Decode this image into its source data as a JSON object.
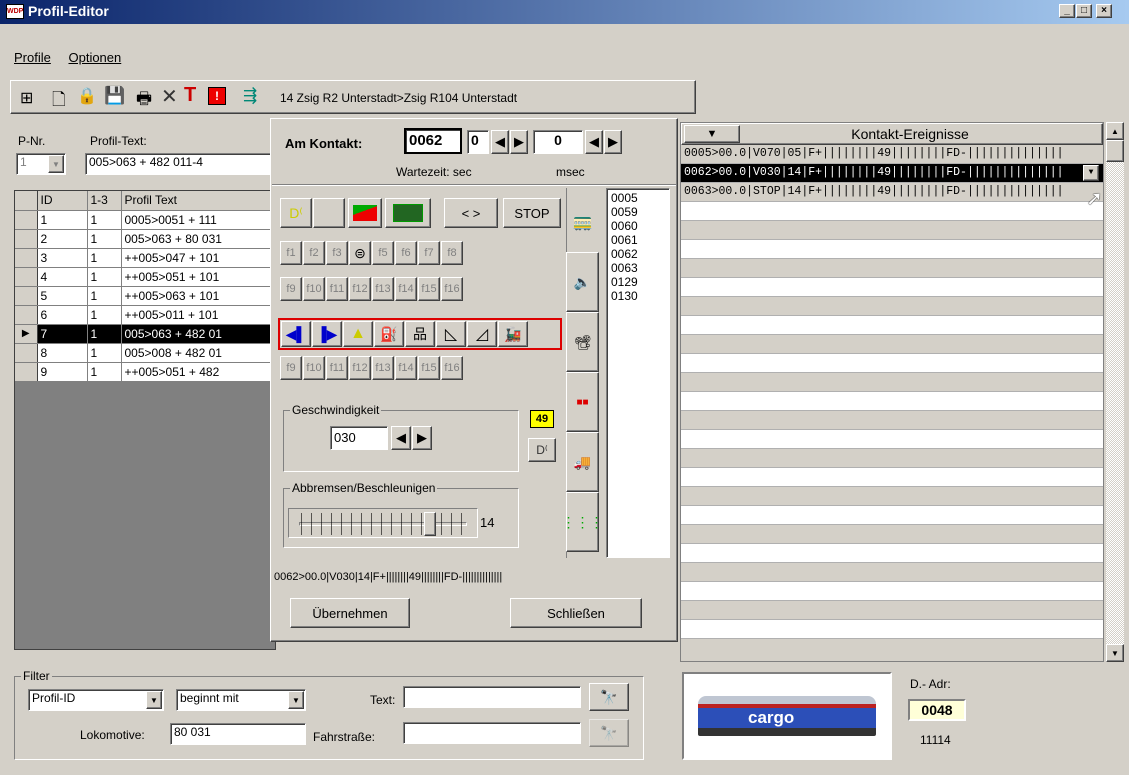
{
  "window": {
    "title": "Profil-Editor",
    "app_icon": "woip-logo-icon"
  },
  "menu": {
    "profile": "Profile",
    "optionen": "Optionen"
  },
  "toolbar": {
    "route_text": "14 Zsig R2 Unterstadt>Zsig R104 Unterstadt",
    "icons": [
      "tree-icon",
      "new-document-icon",
      "lock-document-icon",
      "save-icon",
      "print-icon",
      "delete-icon",
      "filter-t-icon",
      "alert-icon",
      "exit-icon"
    ]
  },
  "left": {
    "pnr_label": "P-Nr.",
    "profiltext_label": "Profil-Text:",
    "pnr_value": "1",
    "profiltext_value": "005>063 + 482 011-4",
    "columns": [
      "ID",
      "1-3",
      "Profil Text"
    ],
    "rows": [
      {
        "id": "1",
        "k": "1",
        "text": "0005>0051 + 111"
      },
      {
        "id": "2",
        "k": "1",
        "text": "005>063 + 80 031"
      },
      {
        "id": "3",
        "k": "1",
        "text": "++005>047 + 101"
      },
      {
        "id": "4",
        "k": "1",
        "text": "++005>051 + 101"
      },
      {
        "id": "5",
        "k": "1",
        "text": "++005>063 + 101"
      },
      {
        "id": "6",
        "k": "1",
        "text": "++005>011 + 101"
      },
      {
        "id": "7",
        "k": "1",
        "text": "005>063 + 482 01"
      },
      {
        "id": "8",
        "k": "1",
        "text": "005>008 + 482 01"
      },
      {
        "id": "9",
        "k": "1",
        "text": "++005>051 + 482"
      }
    ],
    "selected_index": 6
  },
  "dialog": {
    "am_kontakt_label": "Am Kontakt:",
    "kontakt_value": "0062",
    "wait_sec": "0",
    "wait_msec": "0",
    "wartezeit_label": "Wartezeit: sec",
    "msec_label": "msec",
    "stop_label": "STOP",
    "arrows_label": "< >",
    "f_row1": [
      "f1",
      "f2",
      "f3",
      "",
      "f5",
      "f6",
      "f7",
      "f8"
    ],
    "f_row2": [
      "f9",
      "f10",
      "f11",
      "f12",
      "f13",
      "f14",
      "f15",
      "f16"
    ],
    "f_row3": [
      "f9",
      "f10",
      "f11",
      "f12",
      "f13",
      "f14",
      "f15",
      "f16"
    ],
    "geschw_label": "Geschwindigkeit",
    "geschw_value": "030",
    "badge_value": "49",
    "brake_label": "Abbremsen/Beschleunigen",
    "brake_value": "14",
    "brake_level": 0.78,
    "contacts": [
      "0005",
      "0059",
      "0060",
      "0061",
      "0062",
      "0063",
      "0129",
      "0130"
    ],
    "status_text": "0062>00.0|V030|14|F+||||||||49||||||||FD-||||||||||||||",
    "uebernehmen_label": "Übernehmen",
    "schliessen_label": "Schließen"
  },
  "events": {
    "header": "Kontakt-Ereignisse",
    "rows": [
      "0005>00.0|V070|05|F+||||||||49||||||||FD-||||||||||||||",
      "0062>00.0|V030|14|F+||||||||49||||||||FD-||||||||||||||",
      "0063>00.0|STOP|14|F+||||||||49||||||||FD-||||||||||||||"
    ]
  },
  "filter": {
    "legend": "Filter",
    "field_select": "Profil-ID",
    "mode_select": "beginnt mit",
    "text_label": "Text:",
    "text_value": "",
    "lok_label": "Lokomotive:",
    "lok_value": "80 031",
    "fahrstrasse_label": "Fahrstraße:",
    "fahrstrasse_value": ""
  },
  "loco": {
    "image_text": "cargo",
    "dadr_label": "D.- Adr:",
    "dadr_value": "0048",
    "number": "11114"
  },
  "colors": {
    "title_start": "#0a246a",
    "title_end": "#a6caf0",
    "selected_row": "#000000",
    "badge": "#ffff00",
    "accent_red": "#e00000"
  }
}
